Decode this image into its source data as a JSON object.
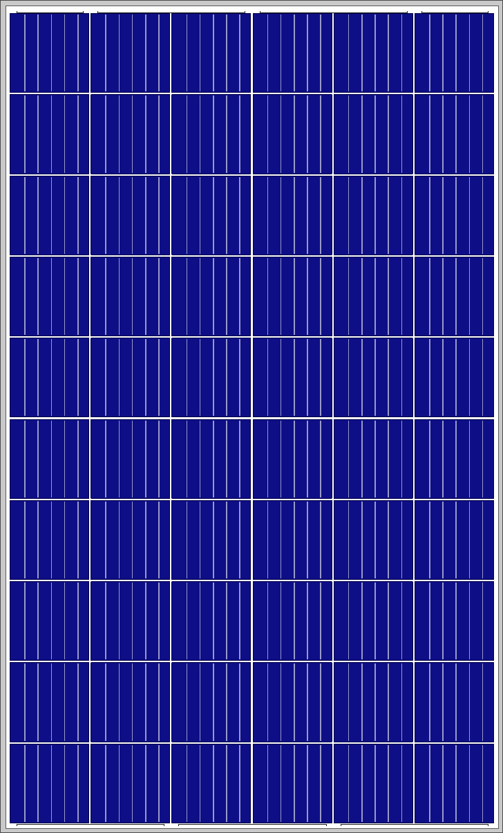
{
  "image": {
    "subject": "solar-panel",
    "cells": {
      "columns": 6,
      "rows": 10,
      "fingers_per_cell": 5
    },
    "colors": {
      "cell": "#0e0e86",
      "cell_edge": "#000048",
      "finger": "#9a9acb",
      "frame": "#c9c9c9",
      "frame_edge": "#4a4a4a"
    }
  }
}
